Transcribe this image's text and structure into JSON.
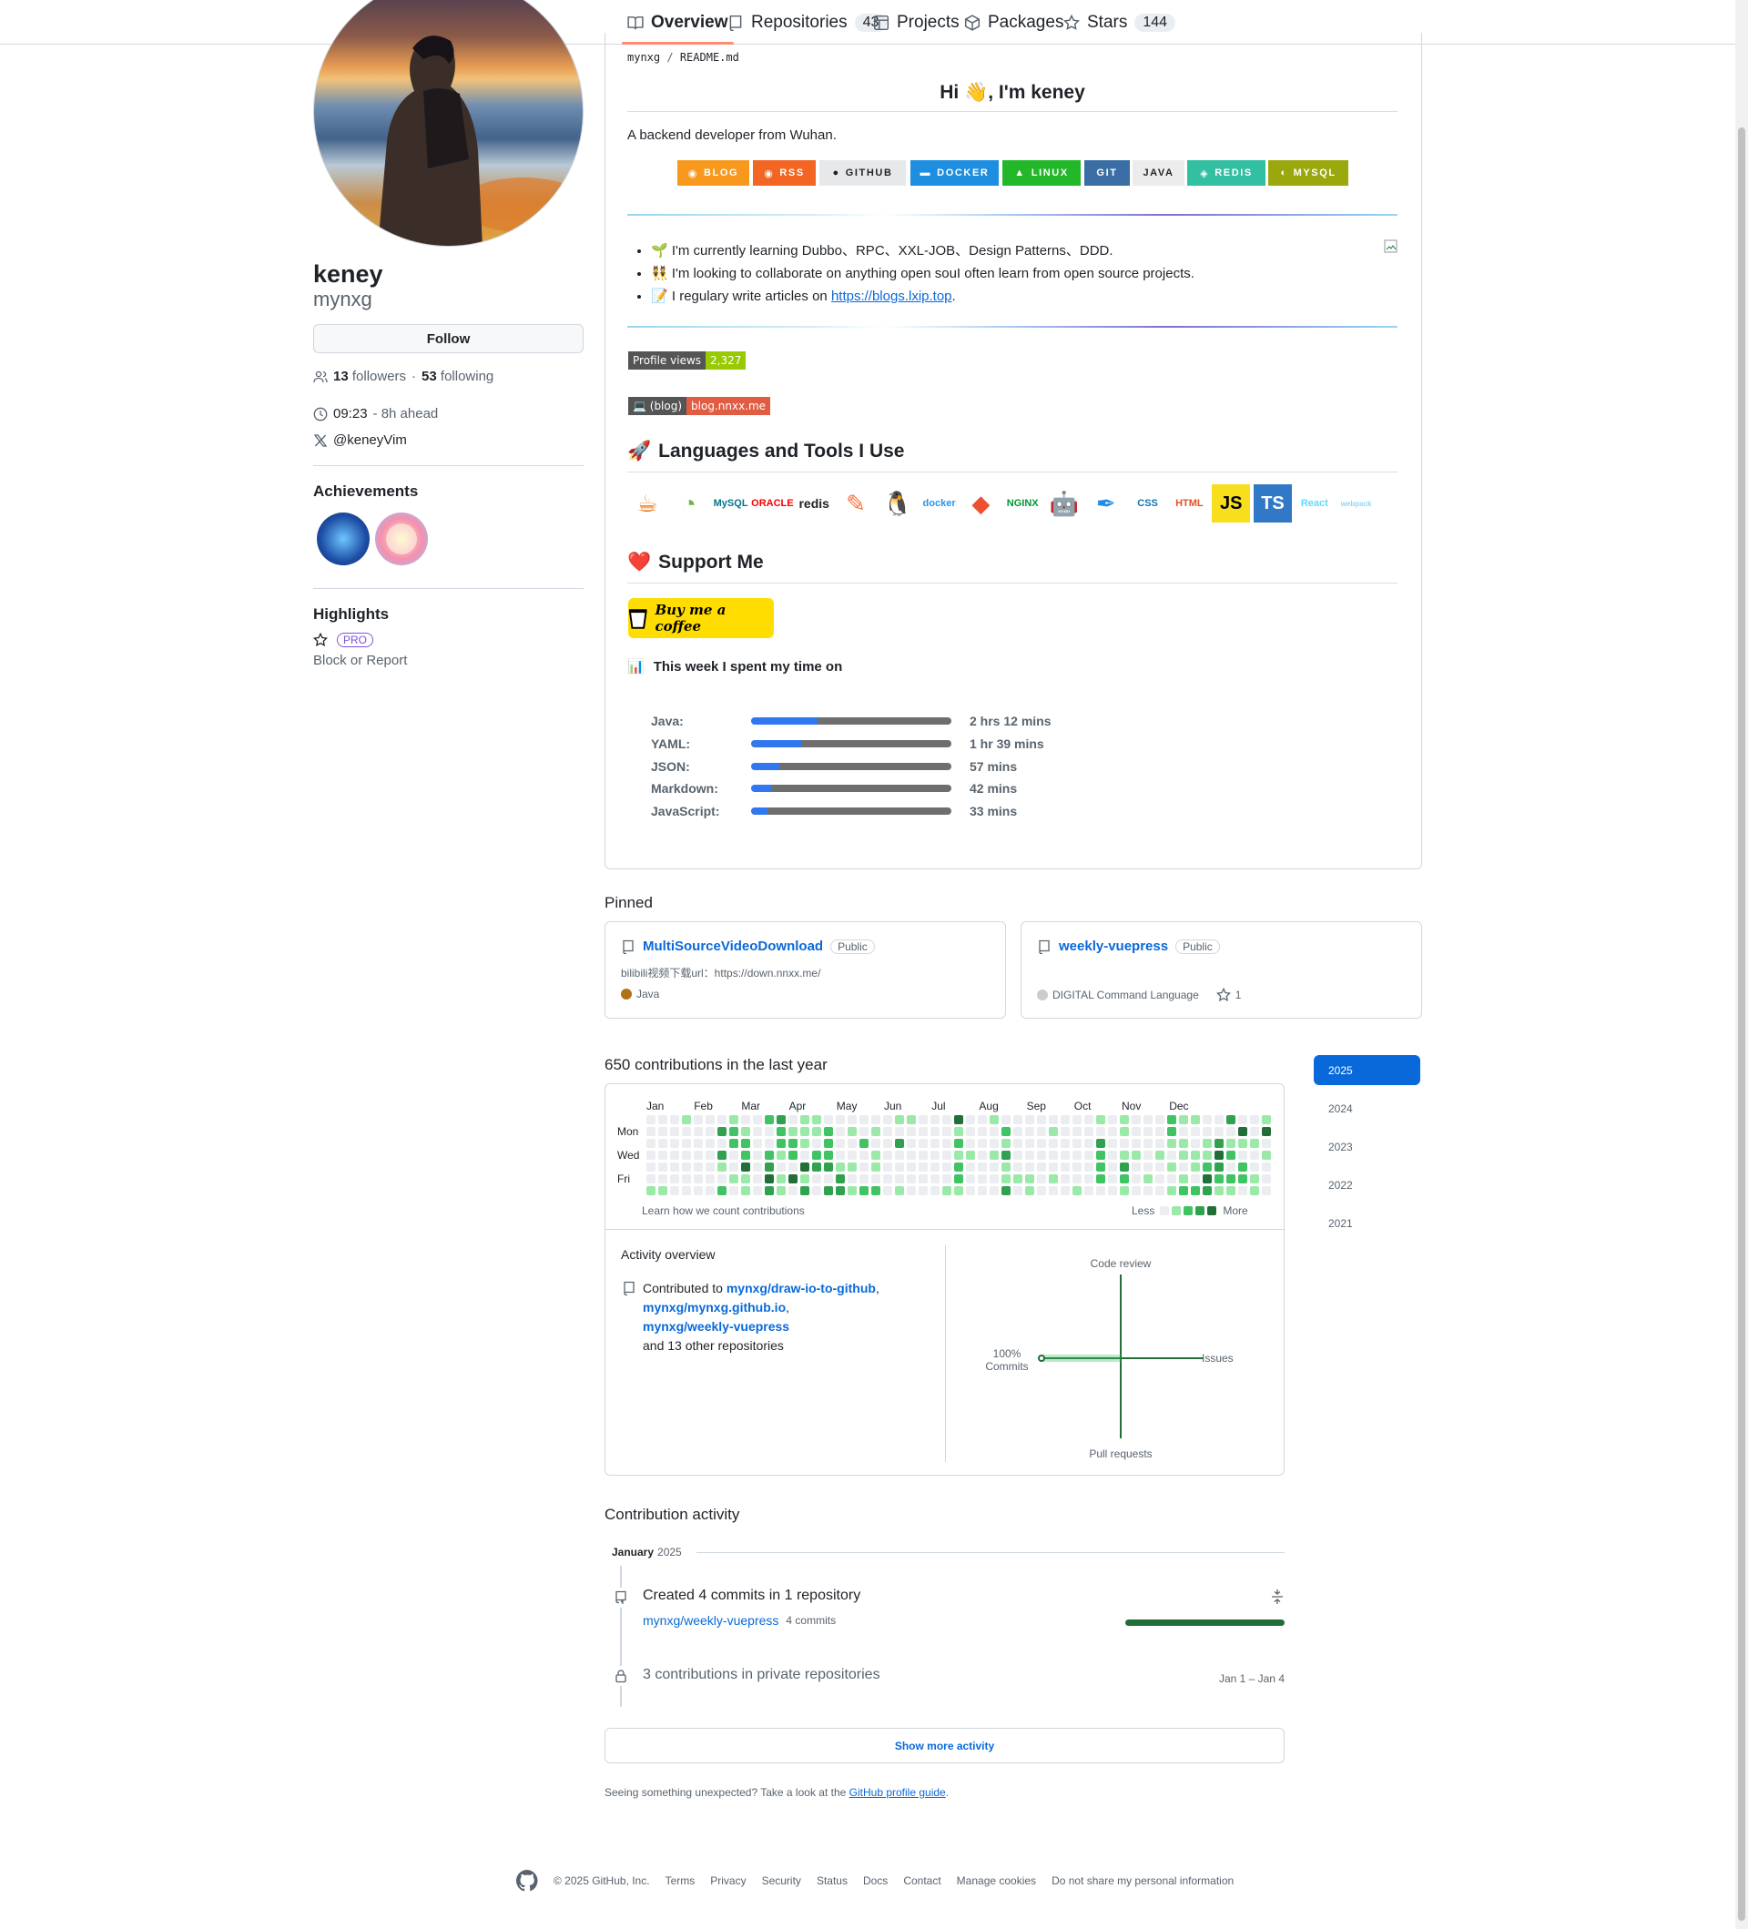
{
  "nav": {
    "tabs": [
      {
        "label": "Overview",
        "count": ""
      },
      {
        "label": "Repositories",
        "count": "43"
      },
      {
        "label": "Projects",
        "count": ""
      },
      {
        "label": "Packages",
        "count": ""
      },
      {
        "label": "Stars",
        "count": "144"
      }
    ]
  },
  "profile": {
    "name": "keney",
    "login": "mynxg",
    "follow_label": "Follow",
    "followers_count": "13",
    "followers_label": "followers",
    "following_count": "53",
    "following_label": "following",
    "separator": "·",
    "local_time": "09:23",
    "time_offset": "- 8h ahead",
    "twitter": "@keneyVim",
    "achievements_title": "Achievements",
    "highlights_title": "Highlights",
    "pro_label": "PRO",
    "block_label": "Block or Report"
  },
  "readme": {
    "crumb_user": "mynxg",
    "crumb_sep": "/",
    "crumb_file": "README.md",
    "greeting": "Hi 👋, I'm keney",
    "intro": "A backend developer from Wuhan.",
    "badges": [
      {
        "label": "BLOG",
        "color": "#f8991d"
      },
      {
        "label": "RSS",
        "color": "#f26522"
      },
      {
        "label": "GITHUB",
        "color": "#e7e8ea"
      },
      {
        "label": "DOCKER",
        "color": "#1d8ee0"
      },
      {
        "label": "LINUX",
        "color": "#22b82a"
      },
      {
        "label": "GIT",
        "color": "#3a6ea5"
      },
      {
        "label": "JAVA",
        "color": "#ececec"
      },
      {
        "label": "REDIS",
        "color": "#33bfa1"
      },
      {
        "label": "MYSQL",
        "color": "#9aa80e"
      }
    ],
    "bullets": [
      {
        "emoji": "🌱",
        "text": "I'm currently learning Dubbo、RPC、XXL-JOB、Design Patterns、DDD."
      },
      {
        "emoji": "👯",
        "text": "I'm looking to collaborate on anything open souI often learn from open source projects."
      },
      {
        "emoji": "📝",
        "text": "I regulary write articles on ",
        "link": "https://blogs.lxip.top",
        "tail": "."
      }
    ],
    "views_label": "Profile views",
    "views_count": "2,327",
    "blog_label": "💻 (blog)",
    "blog_value": "blog.nnxx.me",
    "tools_title": "Languages and Tools I Use",
    "tools_emoji": "🚀",
    "tools": [
      {
        "name": "java-icon",
        "text": "☕",
        "color": "#e76f00"
      },
      {
        "name": "spring-icon",
        "text": "◔",
        "color": "#6db33f"
      },
      {
        "name": "mysql-icon",
        "text": "MySQL",
        "color": "#00758f"
      },
      {
        "name": "oracle-icon",
        "text": "ORACLE",
        "color": "#f80000"
      },
      {
        "name": "redis-icon",
        "text": "redis",
        "color": "#d82c20"
      },
      {
        "name": "postman-icon",
        "text": "✎",
        "color": "#ff6c37"
      },
      {
        "name": "linux-icon",
        "text": "🐧",
        "color": "#000000"
      },
      {
        "name": "docker-icon",
        "text": "docker",
        "color": "#2496ed"
      },
      {
        "name": "git-icon",
        "text": "◆",
        "color": "#f05032"
      },
      {
        "name": "nginx-icon",
        "text": "NGINX",
        "color": "#009639"
      },
      {
        "name": "android-icon",
        "text": "🤖",
        "color": "#3ddc84"
      },
      {
        "name": "quill-icon",
        "text": "✒",
        "color": "#1f8ce6"
      },
      {
        "name": "css3-icon",
        "text": "CSS",
        "color": "#1572b6"
      },
      {
        "name": "html5-icon",
        "text": "HTML",
        "color": "#e34f26"
      },
      {
        "name": "javascript-icon",
        "text": "JS",
        "color": "#f7df1e"
      },
      {
        "name": "typescript-icon",
        "text": "TS",
        "color": "#3178c6"
      },
      {
        "name": "react-icon",
        "text": "React",
        "color": "#61dafb"
      },
      {
        "name": "webpack-icon",
        "text": "webpack",
        "color": "#8dd6f9"
      }
    ],
    "support_title": "Support Me",
    "support_emoji": "❤️",
    "coffee_label": "Buy me a coffee",
    "week_title": "This week I spent my time on",
    "week_emoji": "📊",
    "languages": [
      {
        "name": "Java:",
        "time": "2 hrs 12 mins",
        "fraction": 0.33
      },
      {
        "name": "YAML:",
        "time": "1 hr 39 mins",
        "fraction": 0.25
      },
      {
        "name": "JSON:",
        "time": "57 mins",
        "fraction": 0.14
      },
      {
        "name": "Markdown:",
        "time": "42 mins",
        "fraction": 0.1
      },
      {
        "name": "JavaScript:",
        "time": "33 mins",
        "fraction": 0.08
      }
    ]
  },
  "pinned": {
    "title": "Pinned",
    "items": [
      {
        "name": "MultiSourceVideoDownload",
        "visibility": "Public",
        "desc": "bilibili视频下载url：https://down.nnxx.me/",
        "lang": "Java",
        "lang_color": "#b07219",
        "stars": ""
      },
      {
        "name": "weekly-vuepress",
        "visibility": "Public",
        "desc": "",
        "lang": "DIGITAL Command Language",
        "lang_color": "#cccccc",
        "stars": "1"
      }
    ]
  },
  "contributions": {
    "title": "650 contributions in the last year",
    "months": [
      "Jan",
      "Feb",
      "Mar",
      "Apr",
      "May",
      "Jun",
      "Jul",
      "Aug",
      "Sep",
      "Oct",
      "Nov",
      "Dec"
    ],
    "days": [
      "Mon",
      "Wed",
      "Fri"
    ],
    "learn_label": "Learn how we count contributions",
    "less_label": "Less",
    "more_label": "More",
    "level_colors": [
      "#ebedf0",
      "#9be9a8",
      "#40c463",
      "#30a14e",
      "#216e39"
    ],
    "activity_title": "Activity overview",
    "contributed_to": "Contributed to",
    "repos": [
      "mynxg/draw-io-to-github",
      "mynxg/mynxg.github.io",
      "mynxg/weekly-vuepress"
    ],
    "other_repos": "and 13 other repositories",
    "axes": {
      "top": "Code review",
      "right": "Issues",
      "bottom": "Pull requests",
      "left": "Commits",
      "left_pct": "100%"
    },
    "commits_fraction": 1.0
  },
  "years": [
    "2025",
    "2024",
    "2023",
    "2022",
    "2021"
  ],
  "activity": {
    "title": "Contribution activity",
    "month": "January",
    "year": "2025",
    "event1": "Created 4 commits in 1 repository",
    "event1_repo": "mynxg/weekly-vuepress",
    "event1_commits": "4 commits",
    "event2": "3 contributions in private repositories",
    "event2_date": "Jan 1 – Jan 4",
    "more_label": "Show more activity",
    "seeing_text": "Seeing something unexpected? Take a look at the ",
    "seeing_link": "GitHub profile guide",
    "seeing_tail": "."
  },
  "footer": {
    "copyright": "© 2025 GitHub, Inc.",
    "links": [
      "Terms",
      "Privacy",
      "Security",
      "Status",
      "Docs",
      "Contact",
      "Manage cookies",
      "Do not share my personal information"
    ]
  }
}
